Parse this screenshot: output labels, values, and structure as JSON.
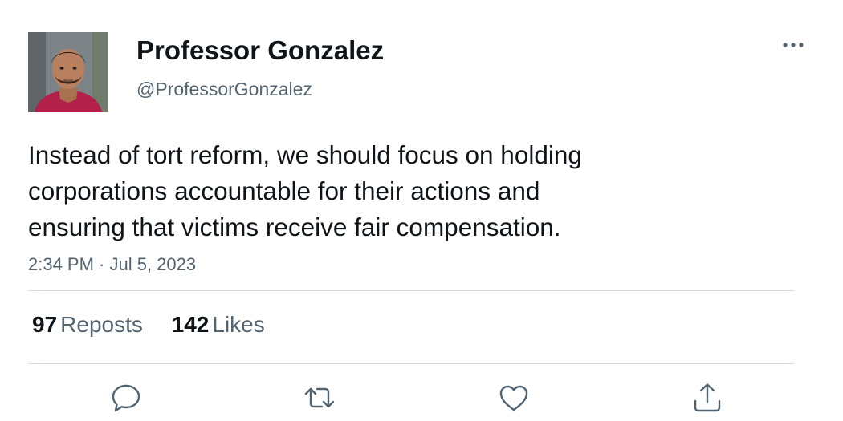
{
  "author": {
    "display_name": "Professor Gonzalez",
    "handle": "@ProfessorGonzalez",
    "avatar": "profile-photo"
  },
  "tweet": {
    "lines": [
      "Instead of tort reform, we should focus on holding",
      "corporations accountable for their actions and",
      "ensuring that victims receive fair compensation."
    ],
    "timestamp": "2:34 PM · Jul 5, 2023"
  },
  "stats": {
    "reposts_count": "97",
    "reposts_label": "Reposts",
    "likes_count": "142",
    "likes_label": "Likes"
  },
  "actions": {
    "icons": [
      "reply-icon",
      "repost-icon",
      "like-icon",
      "share-icon"
    ],
    "more": "more-icon"
  },
  "colors": {
    "primary_text": "#0f1419",
    "secondary_text": "#536471",
    "divider": "#d6dbdf",
    "icon": "#536471"
  }
}
